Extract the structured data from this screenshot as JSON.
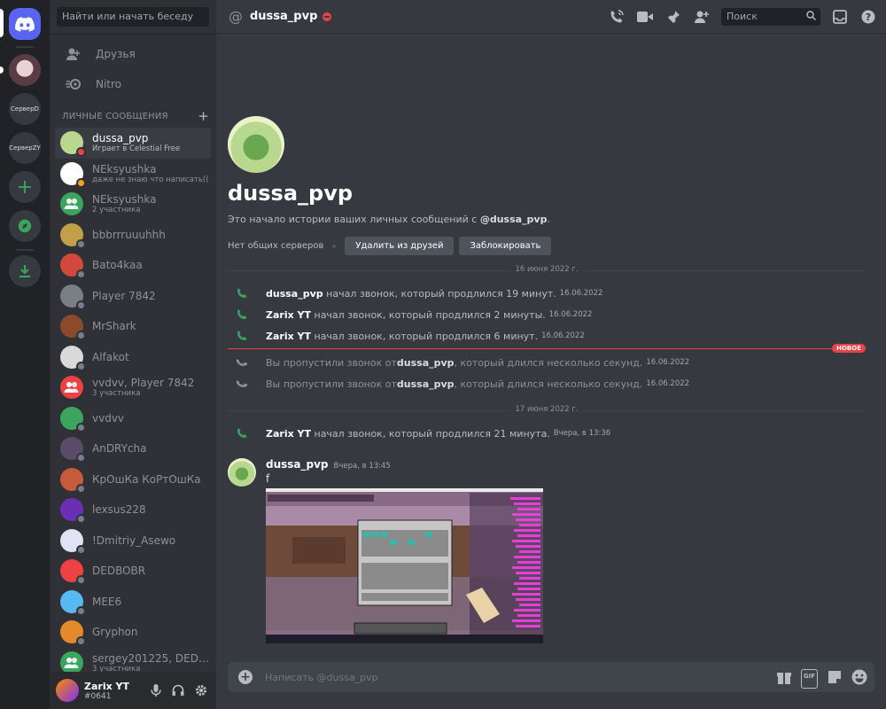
{
  "servers": [
    {
      "label": "СерверD"
    },
    {
      "label": "СерверZY"
    }
  ],
  "sidebar": {
    "search_placeholder": "Найти или начать беседу",
    "nav": [
      {
        "label": "Друзья",
        "icon": "friends-icon"
      },
      {
        "label": "Nitro",
        "icon": "nitro-icon"
      }
    ],
    "dm_header": "ЛИЧНЫЕ СООБЩЕНИЯ",
    "dms": [
      {
        "name": "dussa_pvp",
        "sub": "Играет в Celestial Free",
        "active": true,
        "status": "dnd",
        "color": "#b9d88f"
      },
      {
        "name": "NEksyushka",
        "sub": "даже не знаю что написать((",
        "status": "idle",
        "color": "#ffffff"
      },
      {
        "name": "NEksyushka",
        "sub": "2 участника",
        "group": true,
        "color": "#3ba55d"
      },
      {
        "name": "bbbrrruuuhhh",
        "sub": "",
        "status": "offline",
        "color": "#c2a04a"
      },
      {
        "name": "Bato4kaa",
        "sub": "",
        "status": "offline",
        "color": "#d4473c"
      },
      {
        "name": "Player 7842",
        "sub": "",
        "status": "offline",
        "color": "#7a7f86"
      },
      {
        "name": "MrShark",
        "sub": "",
        "status": "offline",
        "color": "#8a4b2a"
      },
      {
        "name": "Alfakot",
        "sub": "",
        "status": "offline",
        "color": "#d9d9d9"
      },
      {
        "name": "vvdvv, Player 7842",
        "sub": "3 участника",
        "group": true,
        "color": "#ed4245"
      },
      {
        "name": "vvdvv",
        "sub": "",
        "status": "offline",
        "color": "#3ba55d"
      },
      {
        "name": "AnDRYcha",
        "sub": "",
        "status": "offline",
        "color": "#5b4b6b"
      },
      {
        "name": "КрОшКа КоРтОшКа",
        "sub": "",
        "status": "offline",
        "color": "#c85a3c"
      },
      {
        "name": "lexsus228",
        "sub": "",
        "status": "offline",
        "color": "#6a2fb5"
      },
      {
        "name": "!Dmitriy_Asewo",
        "sub": "",
        "status": "offline",
        "color": "#dfe3f3"
      },
      {
        "name": "DEDBOBR",
        "sub": "",
        "status": "offline",
        "color": "#ed4245"
      },
      {
        "name": "MEE6",
        "sub": "",
        "status": "offline",
        "color": "#58b9f0"
      },
      {
        "name": "Gryphon",
        "sub": "",
        "status": "offline",
        "color": "#e38b2c"
      },
      {
        "name": "sergey201225, DEDBO...",
        "sub": "3 участника",
        "group": true,
        "color": "#3ba55d"
      }
    ]
  },
  "user": {
    "name": "Zarix YT",
    "tag": "#0641"
  },
  "header": {
    "title": "dussa_pvp",
    "search_placeholder": "Поиск"
  },
  "intro": {
    "name": "dussa_pvp",
    "text_prefix": "Это начало истории ваших личных сообщений с ",
    "text_user": "@dussa_pvp",
    "text_suffix": ".",
    "no_servers": "Нет общих серверов",
    "remove_friend": "Удалить из друзей",
    "block": "Заблокировать"
  },
  "dates": {
    "d1": "16 июня 2022 г.",
    "d2": "17 июня 2022 г."
  },
  "new_badge": "НОВОЕ",
  "calls": [
    {
      "user": "dussa_pvp",
      "text": " начал звонок, который продлился 19 минут.",
      "ts": "16.06.2022"
    },
    {
      "user": "Zarix YT",
      "text": " начал звонок, который продлился 2 минуты.",
      "ts": "16.06.2022"
    },
    {
      "user": "Zarix YT",
      "text": " начал звонок, который продлился 6 минут.",
      "ts": "16.06.2022"
    },
    {
      "prefix": "Вы пропустили звонок от ",
      "user": "dussa_pvp",
      "text": ", который длился несколько секунд.",
      "ts": "16.06.2022"
    },
    {
      "prefix": "Вы пропустили звонок от ",
      "user": "dussa_pvp",
      "text": ", который длился несколько секунд.",
      "ts": "16.06.2022"
    },
    {
      "user": "Zarix YT",
      "text": " начал звонок, который продлился 21 минута.",
      "ts": "Вчера, в 13:36"
    }
  ],
  "message": {
    "author": "dussa_pvp",
    "ts": "Вчера, в 13:45",
    "body": "f",
    "attachment": "minecraft-screenshot"
  },
  "composer": {
    "placeholder": "Написать @dussa_pvp"
  }
}
